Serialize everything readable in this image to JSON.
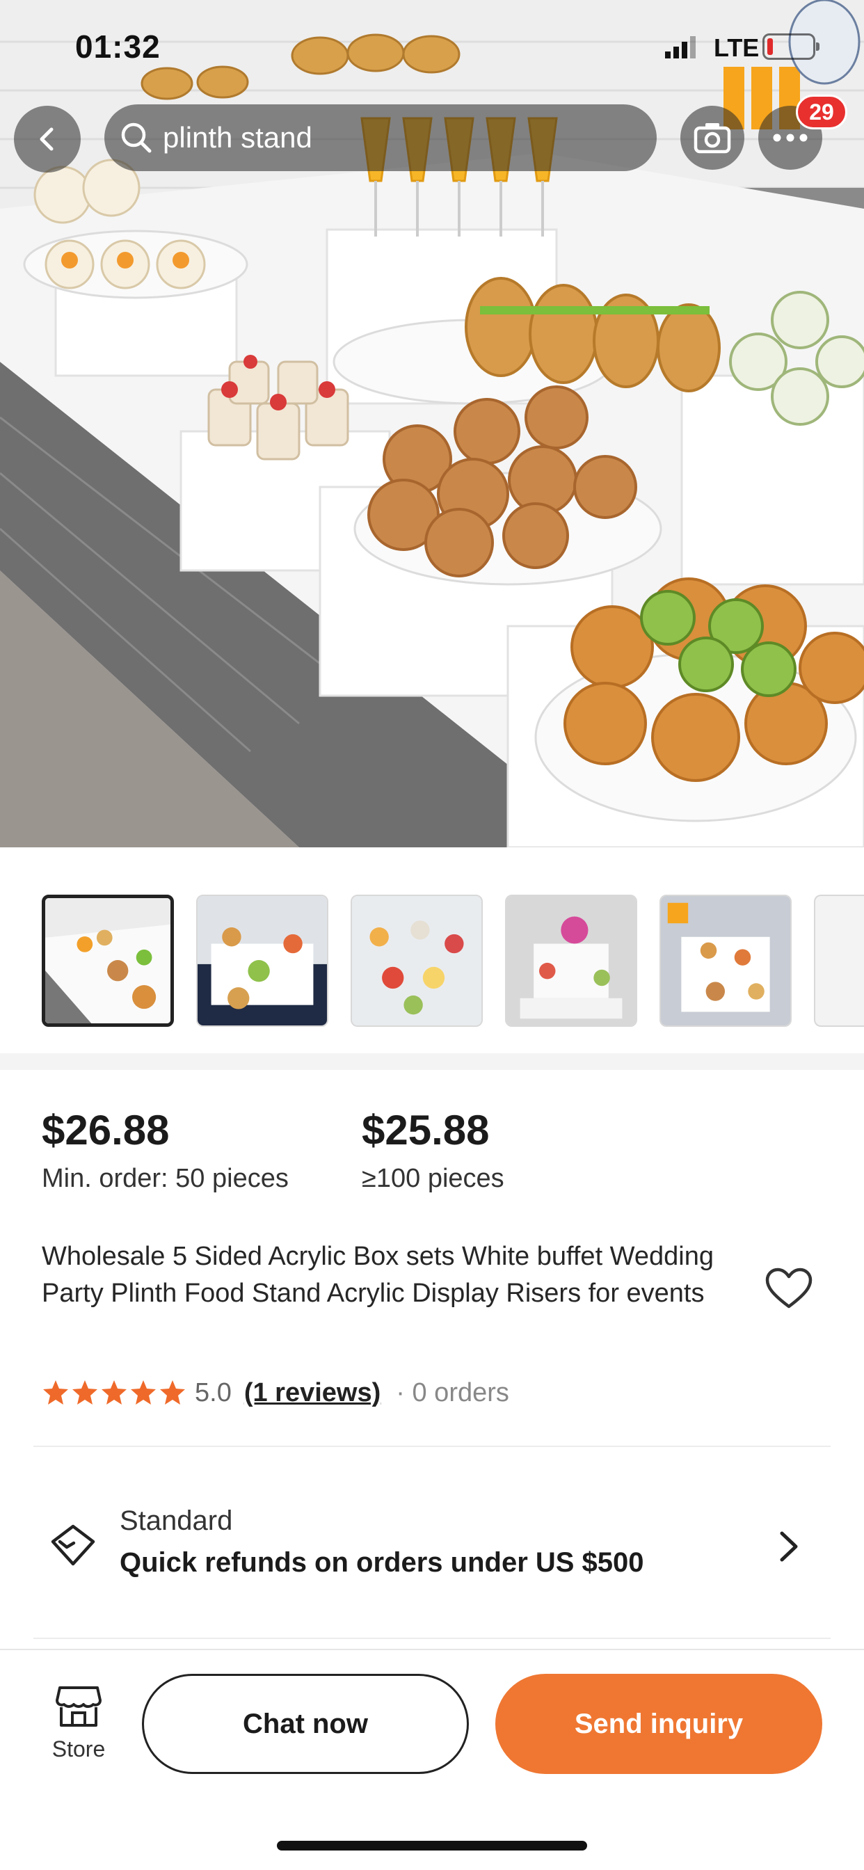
{
  "status_bar": {
    "time": "01:32",
    "network": "LTE"
  },
  "search": {
    "query": "plinth stand"
  },
  "notifications": {
    "count": "29"
  },
  "thumbnails": {
    "count_visible": 6,
    "active_index": 0
  },
  "pricing": {
    "tier1": {
      "price": "$26.88",
      "quantity": "Min. order: 50 pieces"
    },
    "tier2": {
      "price": "$25.88",
      "quantity": "≥100 pieces"
    }
  },
  "product": {
    "title": "Wholesale 5 Sided Acrylic Box sets White buffet Wedding Party Plinth Food Stand Acrylic Display Risers for events",
    "rating_value": "5.0",
    "stars": 5,
    "reviews_text": "(1 reviews)",
    "orders_text": "· 0 orders"
  },
  "standard": {
    "label": "Standard",
    "description": "Quick refunds on orders under US $500"
  },
  "bottom_bar": {
    "store_label": "Store",
    "chat_label": "Chat now",
    "inquiry_label": "Send inquiry"
  },
  "colors": {
    "accent": "#ef7732",
    "badge": "#e8302f",
    "star": "#ef6a2a"
  },
  "icons": [
    "back-icon",
    "search-icon",
    "camera-icon",
    "more-icon",
    "heart-icon",
    "shield-diamond-icon",
    "chevron-right-icon",
    "store-icon",
    "star-icon"
  ]
}
